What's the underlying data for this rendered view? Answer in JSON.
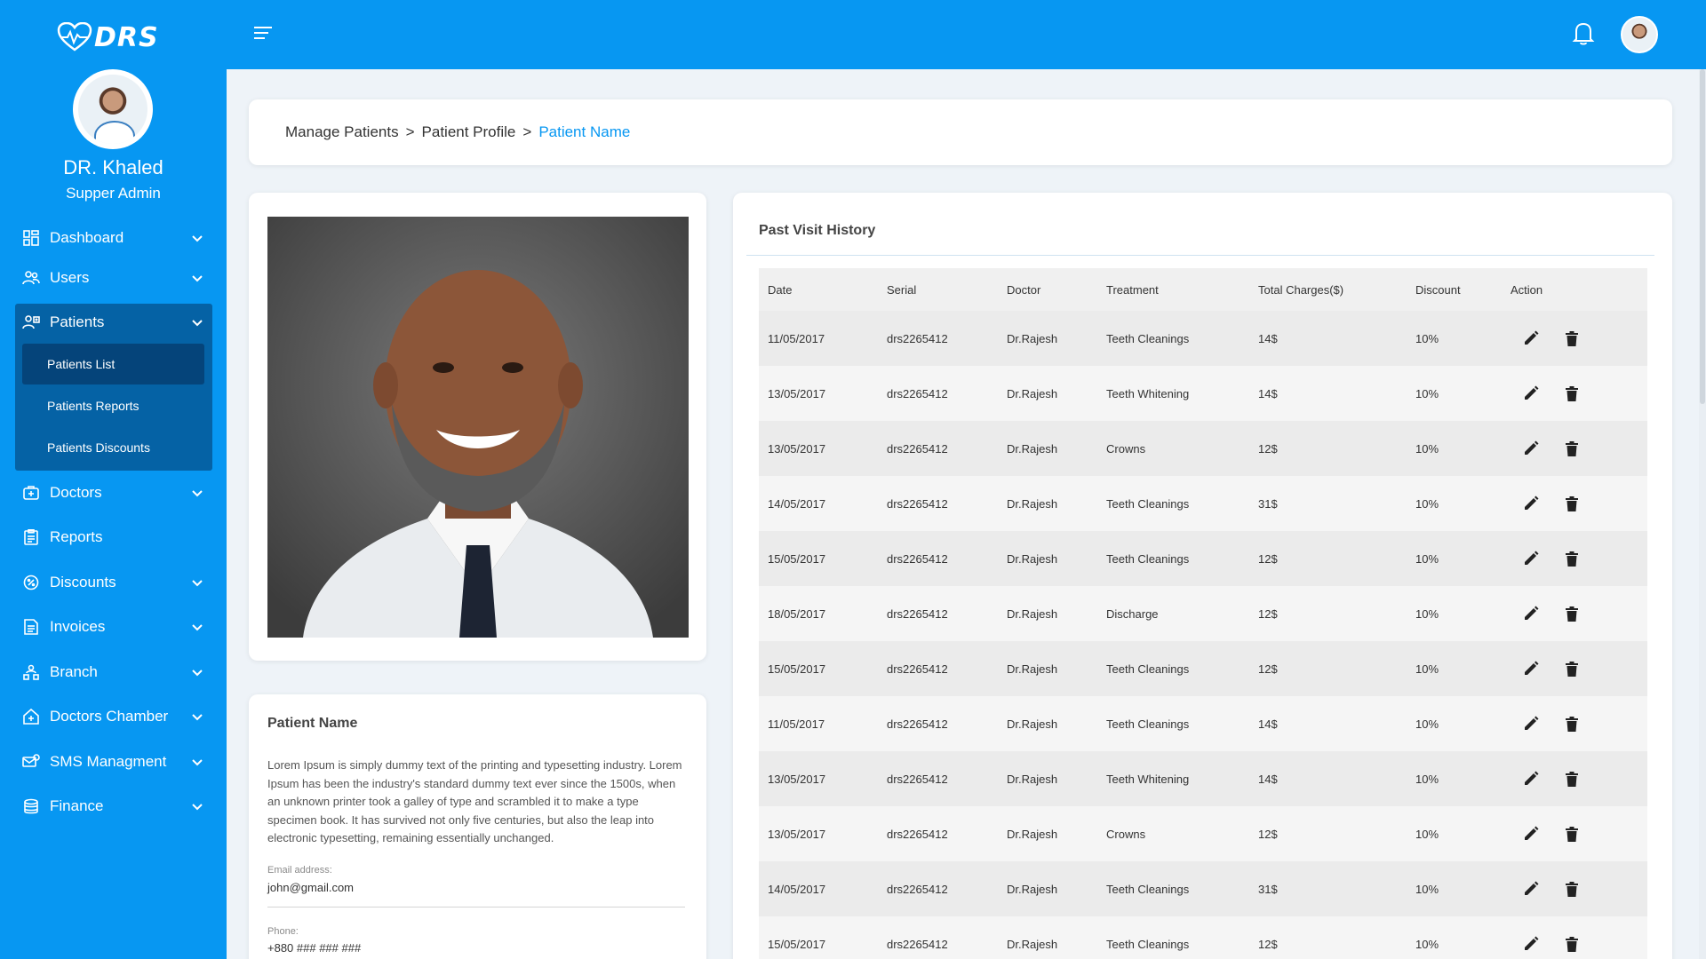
{
  "brand": {
    "logo_text": "DRS"
  },
  "profile": {
    "name": "DR. Khaled",
    "role": "Supper Admin"
  },
  "sidebar": {
    "items": [
      {
        "label": "Dashboard",
        "icon": "dashboard-icon"
      },
      {
        "label": "Users",
        "icon": "users-icon"
      },
      {
        "label": "Patients",
        "icon": "patients-icon"
      },
      {
        "label": "Doctors",
        "icon": "doctors-icon"
      },
      {
        "label": "Reports",
        "icon": "reports-icon"
      },
      {
        "label": "Discounts",
        "icon": "discounts-icon"
      },
      {
        "label": "Invoices",
        "icon": "invoices-icon"
      },
      {
        "label": "Branch",
        "icon": "branch-icon"
      },
      {
        "label": "Doctors Chamber",
        "icon": "chamber-icon"
      },
      {
        "label": "SMS Managment",
        "icon": "sms-icon"
      },
      {
        "label": "Finance",
        "icon": "finance-icon"
      }
    ],
    "patients_submenu": [
      {
        "label": "Patients List",
        "active": true
      },
      {
        "label": "Patients Reports",
        "active": false
      },
      {
        "label": "Patients Discounts",
        "active": false
      }
    ]
  },
  "breadcrumb": {
    "items": [
      "Manage Patients",
      "Patient Profile"
    ],
    "separator": ">",
    "current": "Patient Name"
  },
  "patient": {
    "name": "Patient Name",
    "description": "Lorem Ipsum is simply dummy text of the printing and typesetting industry. Lorem Ipsum has been the industry's standard dummy text ever since the 1500s, when an unknown printer took a galley of type and scrambled it to make a type specimen book. It has survived not only five centuries, but also the leap into electronic typesetting, remaining essentially unchanged.",
    "email_label": "Email address:",
    "email": "john@gmail.com",
    "phone_label": "Phone:",
    "phone": "+880 ### ### ###"
  },
  "history": {
    "title": "Past Visit History",
    "columns": [
      "Date",
      "Serial",
      "Doctor",
      "Treatment",
      "Total Charges($)",
      "Discount",
      "Action"
    ],
    "rows": [
      [
        "11/05/2017",
        "drs2265412",
        "Dr.Rajesh",
        "Teeth Cleanings",
        "14$",
        "10%"
      ],
      [
        "13/05/2017",
        "drs2265412",
        "Dr.Rajesh",
        "Teeth Whitening",
        "14$",
        "10%"
      ],
      [
        "13/05/2017",
        "drs2265412",
        "Dr.Rajesh",
        "Crowns",
        "12$",
        "10%"
      ],
      [
        "14/05/2017",
        "drs2265412",
        "Dr.Rajesh",
        "Teeth Cleanings",
        "31$",
        "10%"
      ],
      [
        "15/05/2017",
        "drs2265412",
        "Dr.Rajesh",
        "Teeth Cleanings",
        "12$",
        "10%"
      ],
      [
        "18/05/2017",
        "drs2265412",
        "Dr.Rajesh",
        "Discharge",
        "12$",
        "10%"
      ],
      [
        "15/05/2017",
        "drs2265412",
        "Dr.Rajesh",
        "Teeth Cleanings",
        "12$",
        "10%"
      ],
      [
        "11/05/2017",
        "drs2265412",
        "Dr.Rajesh",
        "Teeth Cleanings",
        "14$",
        "10%"
      ],
      [
        "13/05/2017",
        "drs2265412",
        "Dr.Rajesh",
        "Teeth Whitening",
        "14$",
        "10%"
      ],
      [
        "13/05/2017",
        "drs2265412",
        "Dr.Rajesh",
        "Crowns",
        "12$",
        "10%"
      ],
      [
        "14/05/2017",
        "drs2265412",
        "Dr.Rajesh",
        "Teeth Cleanings",
        "31$",
        "10%"
      ],
      [
        "15/05/2017",
        "drs2265412",
        "Dr.Rajesh",
        "Teeth Cleanings",
        "12$",
        "10%"
      ]
    ]
  },
  "colors": {
    "primary": "#0797f2",
    "submenu_bg": "#0562a5",
    "submenu_active": "#05447a"
  }
}
